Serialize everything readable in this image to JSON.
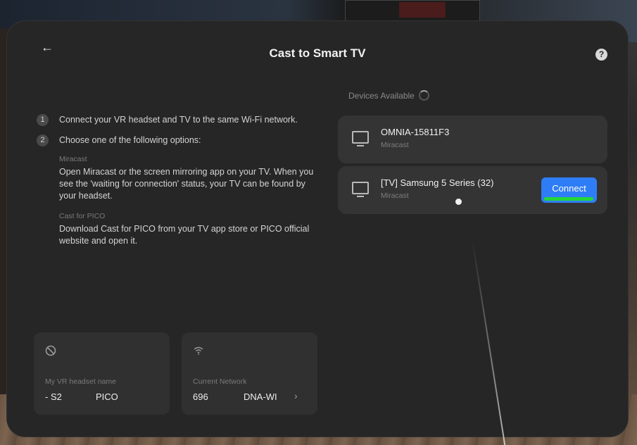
{
  "header": {
    "back_glyph": "←",
    "title": "Cast to Smart TV",
    "help_glyph": "?"
  },
  "instructions": {
    "steps": [
      {
        "number": "1",
        "text": "Connect your VR headset and TV to the same Wi-Fi network."
      },
      {
        "number": "2",
        "text": "Choose one of the following options:"
      }
    ],
    "options": [
      {
        "label": "Miracast",
        "text": "Open Miracast or the screen mirroring app on your TV. When you see the 'waiting for connection' status, your TV can be found by your headset."
      },
      {
        "label": "Cast for PICO",
        "text": "Download Cast for PICO from your TV app store or PICO official website and open it."
      }
    ]
  },
  "devices": {
    "header": "Devices Available",
    "items": [
      {
        "name": "OMNIA-15811F3",
        "type": "Miracast"
      },
      {
        "name": "[TV] Samsung 5 Series (32)",
        "type": "Miracast",
        "action": "Connect"
      }
    ]
  },
  "cards": {
    "headset": {
      "label": "My VR headset name",
      "value_a": "- S2",
      "value_b": "PICO"
    },
    "network": {
      "label": "Current Network",
      "value_a": "696",
      "value_b": "DNA-WI",
      "chevron": "›"
    }
  },
  "colors": {
    "panel_bg": "#262626",
    "card_bg": "#343434",
    "accent_blue": "#2f7df6",
    "accent_green": "#24d63a"
  }
}
